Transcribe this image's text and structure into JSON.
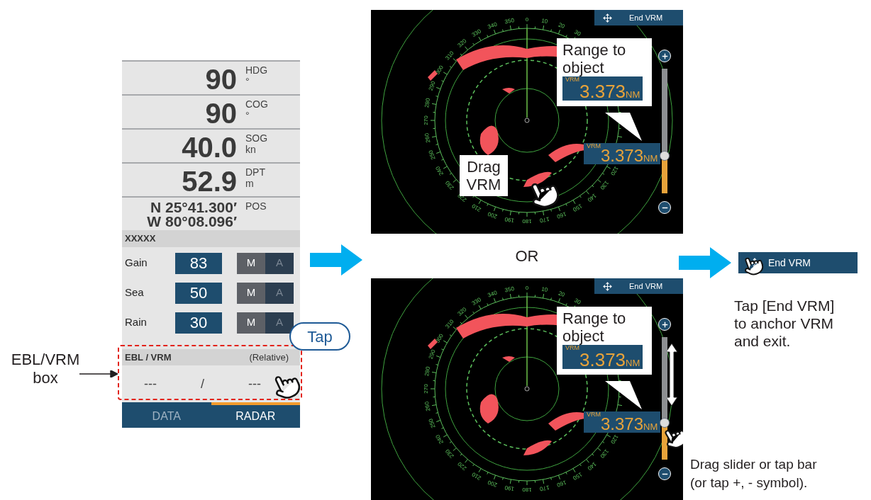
{
  "annotation": {
    "box_label": "EBL/VRM box",
    "tap_bubble": "Tap"
  },
  "panel": {
    "readouts": [
      {
        "kind": "big",
        "value": "90",
        "label": "HDG",
        "unit": "°"
      },
      {
        "kind": "big",
        "value": "90",
        "label": "COG",
        "unit": "°"
      },
      {
        "kind": "big",
        "value": "40.0",
        "label": "SOG",
        "unit": "kn"
      },
      {
        "kind": "big",
        "value": "52.9",
        "label": "DPT",
        "unit": "m"
      },
      {
        "kind": "position",
        "lines": [
          "N 25°41.300′",
          "W 80°08.096′"
        ],
        "label": "POS"
      }
    ],
    "section_title": "XXXXX",
    "controls": [
      {
        "label": "Gain",
        "value": "83",
        "modes": [
          {
            "label": "M",
            "selected": true
          },
          {
            "label": "A",
            "selected": false
          }
        ]
      },
      {
        "label": "Sea",
        "value": "50",
        "modes": [
          {
            "label": "M",
            "selected": true
          },
          {
            "label": "A",
            "selected": false
          }
        ]
      },
      {
        "label": "Rain",
        "value": "30",
        "modes": [
          {
            "label": "M",
            "selected": true
          },
          {
            "label": "A",
            "selected": false
          }
        ]
      }
    ],
    "ebl_vrm": {
      "title": "EBL / VRM",
      "mode": "(Relative)",
      "ebl": "---",
      "separator": "/",
      "vrm": "---"
    },
    "tabs": [
      {
        "label": "DATA",
        "selected": false
      },
      {
        "label": "RADAR",
        "selected": true
      }
    ]
  },
  "radars": [
    {
      "end_button": "End VRM",
      "bearing_labels": [
        "120",
        "130",
        "140",
        "150",
        "160",
        "170",
        "180",
        "190",
        "200",
        "210",
        "220",
        "230",
        "240",
        "250",
        "260",
        "270",
        "280",
        "290",
        "300",
        "310",
        "320",
        "330",
        "340",
        "350",
        "0",
        "10",
        "20",
        "30"
      ],
      "callout": "Range to object",
      "callout_readout": {
        "label": "VRM",
        "value": "3.373",
        "unit": "NM"
      },
      "vrm_readout": {
        "label": "VRM",
        "value": "3.373",
        "unit": "NM"
      },
      "slider": {
        "level": 0.3
      },
      "drag_note": "Drag VRM"
    },
    {
      "end_button": "End VRM",
      "bearing_labels": [
        "120",
        "130",
        "140",
        "150",
        "160",
        "170",
        "180",
        "190",
        "200",
        "210",
        "220",
        "230",
        "240",
        "250",
        "260",
        "270",
        "280",
        "290",
        "300",
        "310",
        "320",
        "330",
        "340",
        "350",
        "0",
        "10",
        "20",
        "30"
      ],
      "callout": "Range to object",
      "callout_readout": {
        "label": "VRM",
        "value": "3.373",
        "unit": "NM"
      },
      "vrm_readout": {
        "label": "VRM",
        "value": "3.373",
        "unit": "NM"
      },
      "slider": {
        "level": 0.3
      }
    }
  ],
  "or_label": "OR",
  "end_vrm_button": "End VRM",
  "end_note": "Tap [End VRM]\nto anchor VRM\nand exit.",
  "slider_note": "Drag slider or tap bar\n(or  tap +, - symbol)."
}
